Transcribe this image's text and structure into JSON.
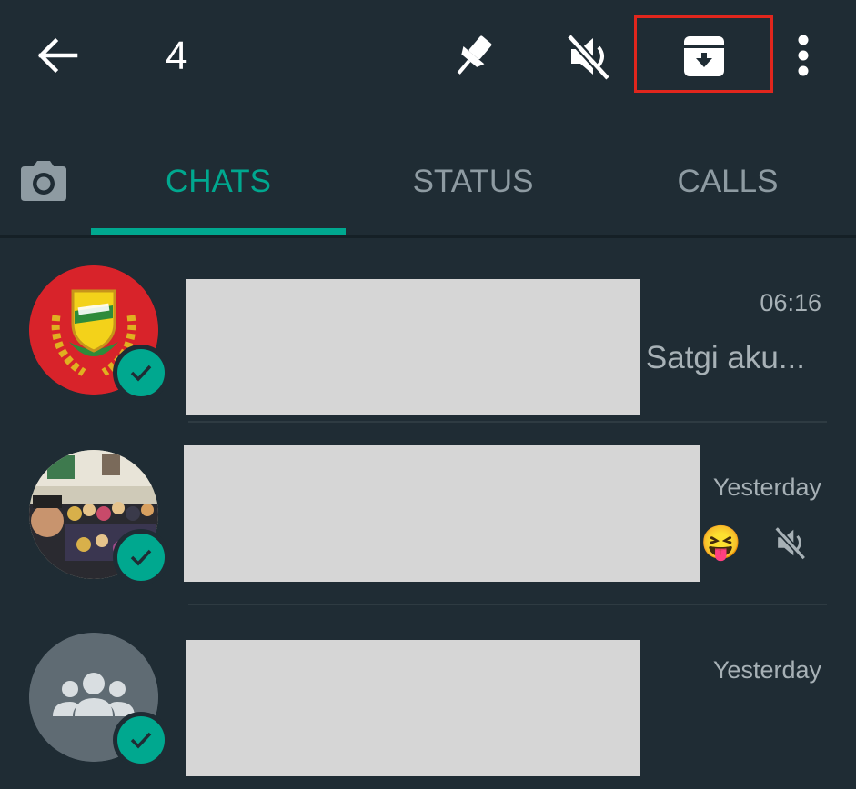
{
  "selection": {
    "count": "4"
  },
  "toolbar": {
    "actions": [
      "back-arrow-icon",
      "pin-icon",
      "mute-icon",
      "archive-icon",
      "more-vert-icon"
    ],
    "highlighted_action": "archive"
  },
  "tabs": [
    {
      "label": "CHATS",
      "active": true
    },
    {
      "label": "STATUS",
      "active": false
    },
    {
      "label": "CALLS",
      "active": false
    }
  ],
  "chats": [
    {
      "time": "06:16",
      "preview": "Satgi aku...",
      "selected": true,
      "muted": false
    },
    {
      "time": "Yesterday",
      "preview_emoji": "😝",
      "selected": true,
      "muted": true
    },
    {
      "time": "Yesterday",
      "selected": true,
      "muted": false
    }
  ],
  "colors": {
    "background": "#1f2c34",
    "accent": "#00a88f",
    "tab_inactive": "#8e9ba2",
    "secondary_text": "#a7b1b6",
    "highlight_box": "#e0261d",
    "redaction": "#d6d6d6"
  }
}
